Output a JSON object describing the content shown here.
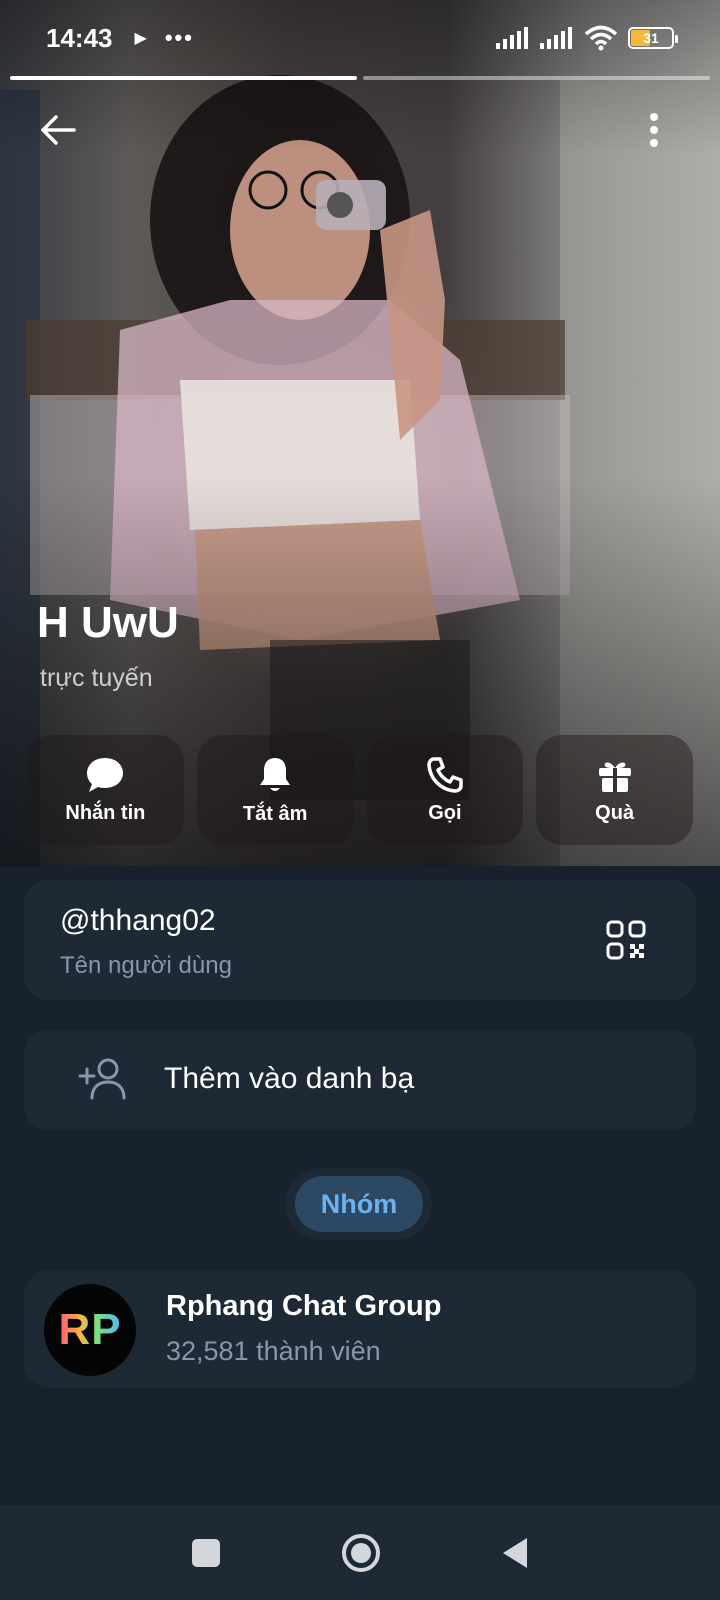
{
  "status_bar": {
    "time": "14:43",
    "play_icon": "▶",
    "dots": "•••",
    "battery_level": "31"
  },
  "story": {
    "segments": 2,
    "active_segment": 1
  },
  "profile": {
    "name": "H UwU",
    "status": "trực tuyến"
  },
  "actions": [
    {
      "label": "Nhắn tin",
      "icon": "chat-bubble-icon"
    },
    {
      "label": "Tắt âm",
      "icon": "bell-icon"
    },
    {
      "label": "Gọi",
      "icon": "phone-icon"
    },
    {
      "label": "Quà",
      "icon": "gift-icon"
    }
  ],
  "username": {
    "value": "@thhang02",
    "label": "Tên người dùng"
  },
  "add_contact": {
    "label": "Thêm vào danh bạ"
  },
  "groups_tab": {
    "label": "Nhóm"
  },
  "group": {
    "avatar_text": "RP",
    "name": "Rphang Chat Group",
    "members": "32,581 thành viên"
  },
  "colors": {
    "background": "#18222d",
    "card": "#1e2936",
    "accent": "#6db2ec",
    "muted_text": "#8797a6"
  }
}
